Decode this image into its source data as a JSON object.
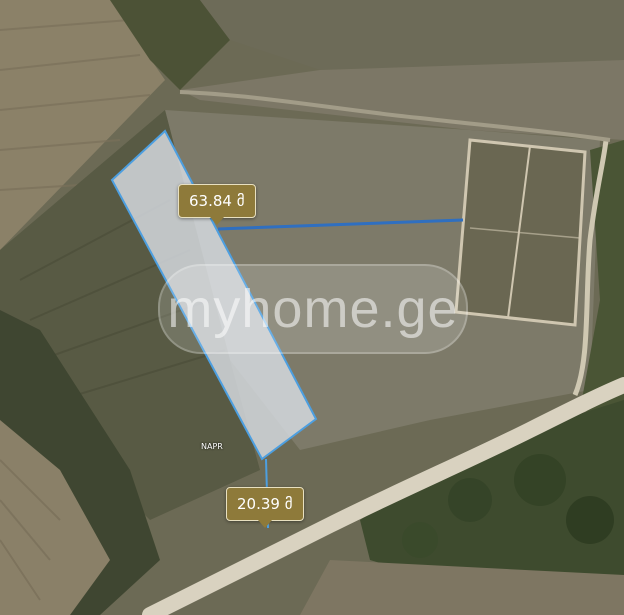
{
  "map": {
    "distance_labels": [
      {
        "value": "63.84 მ"
      },
      {
        "value": "20.39 მ"
      }
    ],
    "plot_tag": "NAPR",
    "watermark": "myhome.ge",
    "colors": {
      "boundary": "#4d9fe0",
      "measure_line": "#2f6fc0",
      "label_bg": "#8e7a3a",
      "plot_fill": "#d8dde3"
    }
  }
}
